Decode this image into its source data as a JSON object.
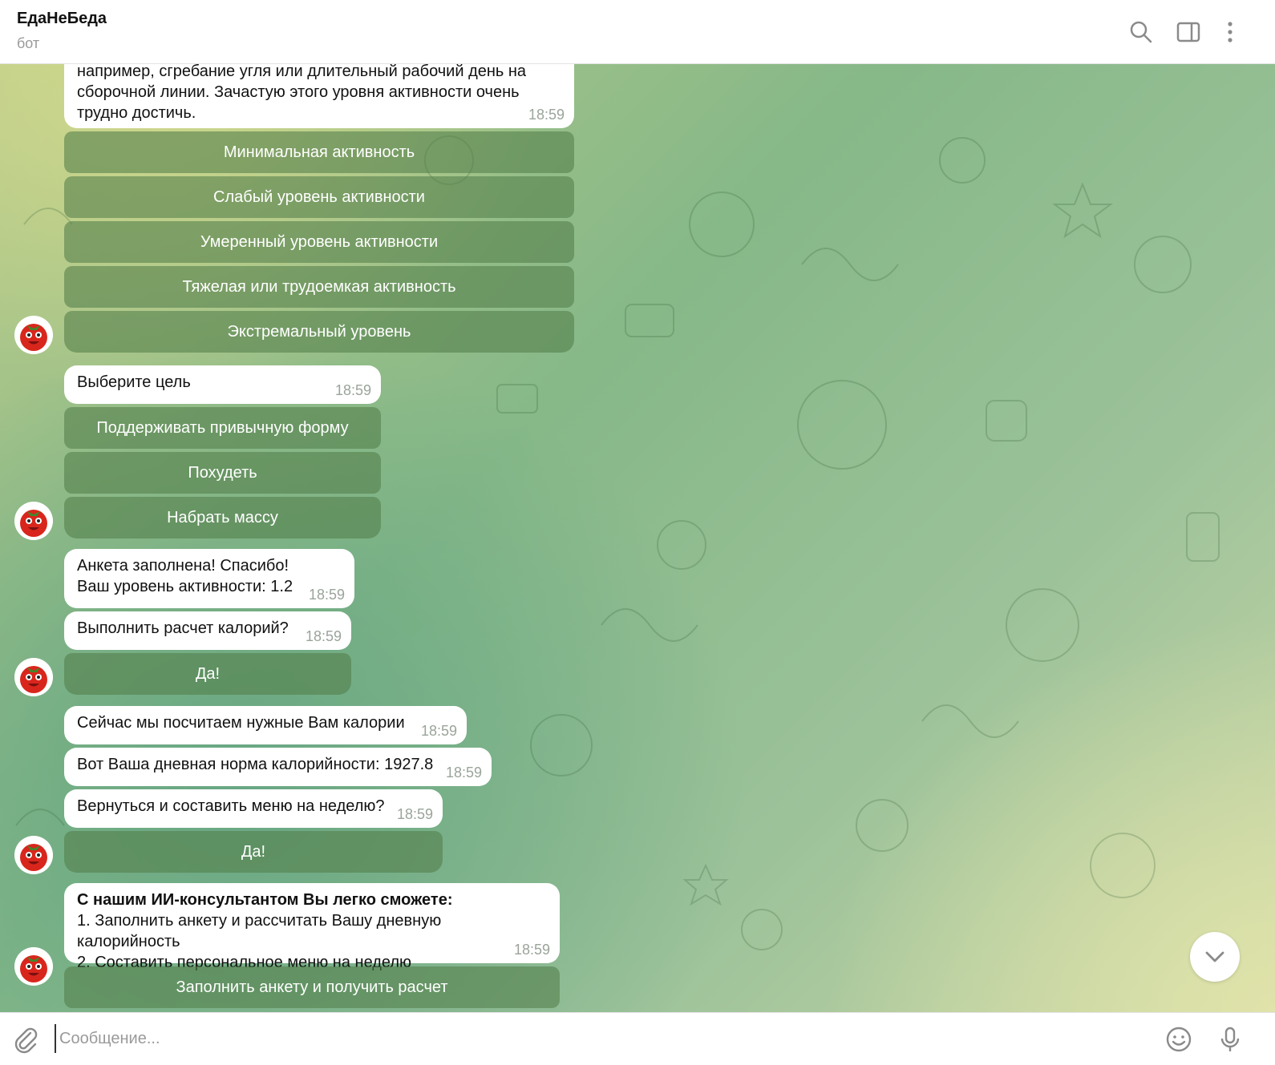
{
  "header": {
    "title": "ЕдаНеБеда",
    "subtitle": "бот",
    "icons": [
      "search-icon",
      "sidebar-toggle-icon",
      "more-vertical-icon"
    ]
  },
  "messages": {
    "m1": {
      "lines": [
        "например, сгребание угля или длительный рабочий день на",
        "сборочной линии. Зачастую этого уровня активности очень",
        "трудно достичь."
      ],
      "time": "18:59"
    },
    "activity_buttons": [
      "Минимальная активность",
      "Слабый уровень активности",
      "Умеренный уровень активности",
      "Тяжелая или трудоемкая активность",
      "Экстремальный уровень"
    ],
    "m2": {
      "text": "Выберите цель",
      "time": "18:59"
    },
    "goal_buttons": [
      "Поддерживать привычную форму",
      "Похудеть",
      "Набрать массу"
    ],
    "m3": {
      "lines": [
        "Анкета заполнена! Спасибо!",
        "Ваш уровень активности: 1.2"
      ],
      "time": "18:59"
    },
    "m4": {
      "text": "Выполнить расчет калорий?",
      "time": "18:59"
    },
    "yes_button_1": "Да!",
    "m5": {
      "text": "Сейчас мы посчитаем нужные Вам калории",
      "time": "18:59"
    },
    "m6": {
      "text": "Вот Ваша дневная норма калорийности: 1927.8",
      "time": "18:59"
    },
    "m7": {
      "text": "Вернуться и составить меню на неделю?",
      "time": "18:59"
    },
    "yes_button_2": "Да!",
    "m8": {
      "heading": "С нашим ИИ-консультантом Вы легко сможете:",
      "lines": [
        "1. Заполнить анкету и рассчитать Вашу дневную калорийность",
        "2. Составить персональное меню на неделю"
      ],
      "time": "18:59"
    },
    "fill_form_button": "Заполнить анкету и получить расчет"
  },
  "composer": {
    "placeholder": "Сообщение...",
    "icons": [
      "attach-icon",
      "emoji-icon",
      "microphone-icon"
    ]
  },
  "colors": {
    "keyboard_button": "#527d4a",
    "bubble": "#ffffff",
    "time_text": "#9aa49a"
  }
}
